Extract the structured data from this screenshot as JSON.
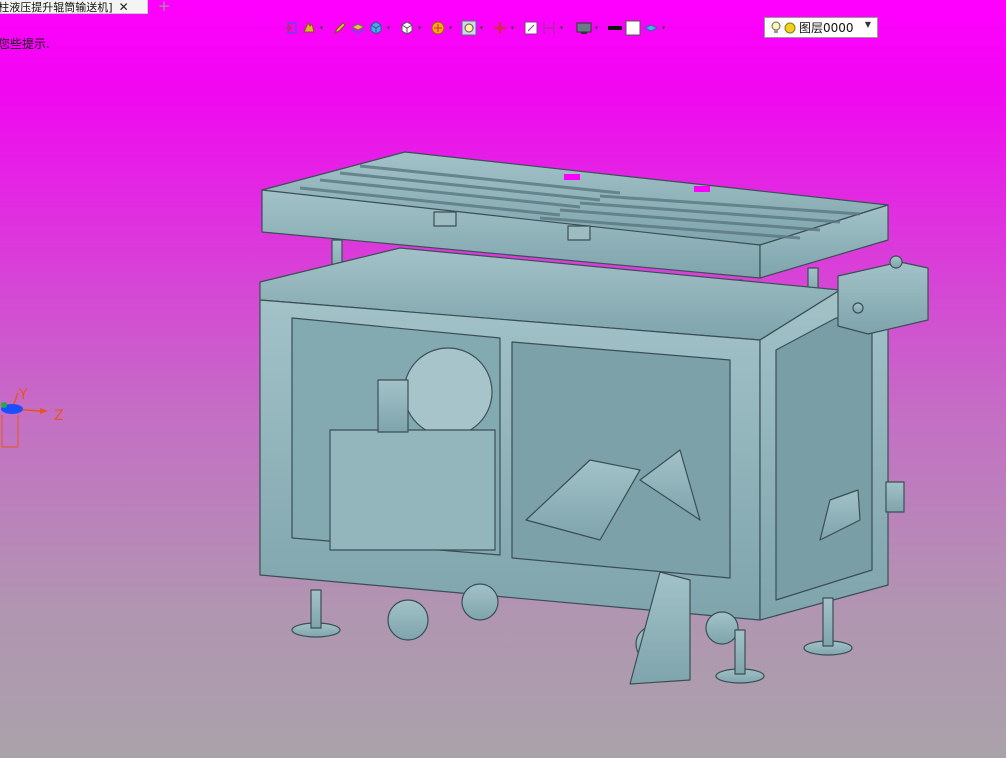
{
  "document_tab": {
    "title": "[柱液压提升辊筒输送机]",
    "close_glyph": "✕",
    "new_tab_glyph": "+"
  },
  "hint": {
    "text": "您些提示."
  },
  "toolbar": {
    "layer": {
      "name": "图层0000"
    },
    "colors": {
      "line": "#111111",
      "fill": "#ffffff"
    }
  },
  "triad": {
    "y_label": "Y",
    "z_label": "Z",
    "x_color": "#1a4fff",
    "y_color": "#e8541e",
    "z_color": "#e8541e"
  },
  "viewport": {
    "gradient": [
      "#ff00ff",
      "#c46fc4",
      "#aaa2aa"
    ],
    "model_color": "#8fb5bd",
    "model_outline": "#3a4f55"
  }
}
